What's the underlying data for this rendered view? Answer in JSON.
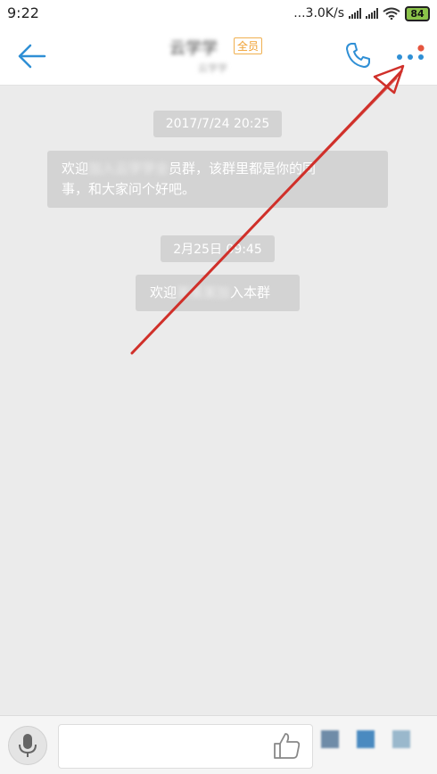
{
  "status_bar": {
    "time": "9:22",
    "network_speed": "...3.0K/s",
    "battery": "84",
    "icons": [
      "signal-icon",
      "signal-icon",
      "wifi-icon",
      "battery-icon"
    ]
  },
  "header": {
    "back_icon": "arrow-left-icon",
    "title": "云学学",
    "title_badge": "全员",
    "subtitle": "云学学",
    "call_icon": "phone-icon",
    "more_icon": "more-dots-icon",
    "accent_color": "#2f8fd5",
    "notification_dot_color": "#e5553f"
  },
  "chat": {
    "messages": [
      {
        "type": "timestamp",
        "text": "2017/7/24 20:25"
      },
      {
        "type": "system",
        "prefix": "欢迎",
        "redacted": "加入云学学全",
        "middle": "员群，该群里都是你的同",
        "line2": "事，和大家问个好吧。"
      },
      {
        "type": "timestamp",
        "text": "2月25日 09:45"
      },
      {
        "type": "system",
        "prefix": "欢迎",
        "redacted": "某某某加",
        "suffix": "入本群"
      }
    ]
  },
  "annotation": {
    "type": "red-arrow",
    "color": "#d0302a"
  },
  "input_bar": {
    "voice_icon": "microphone-icon",
    "input_value": "",
    "like_icon": "thumbs-up-icon",
    "quick_icons": [
      "app-icon",
      "app-icon",
      "app-icon"
    ]
  }
}
